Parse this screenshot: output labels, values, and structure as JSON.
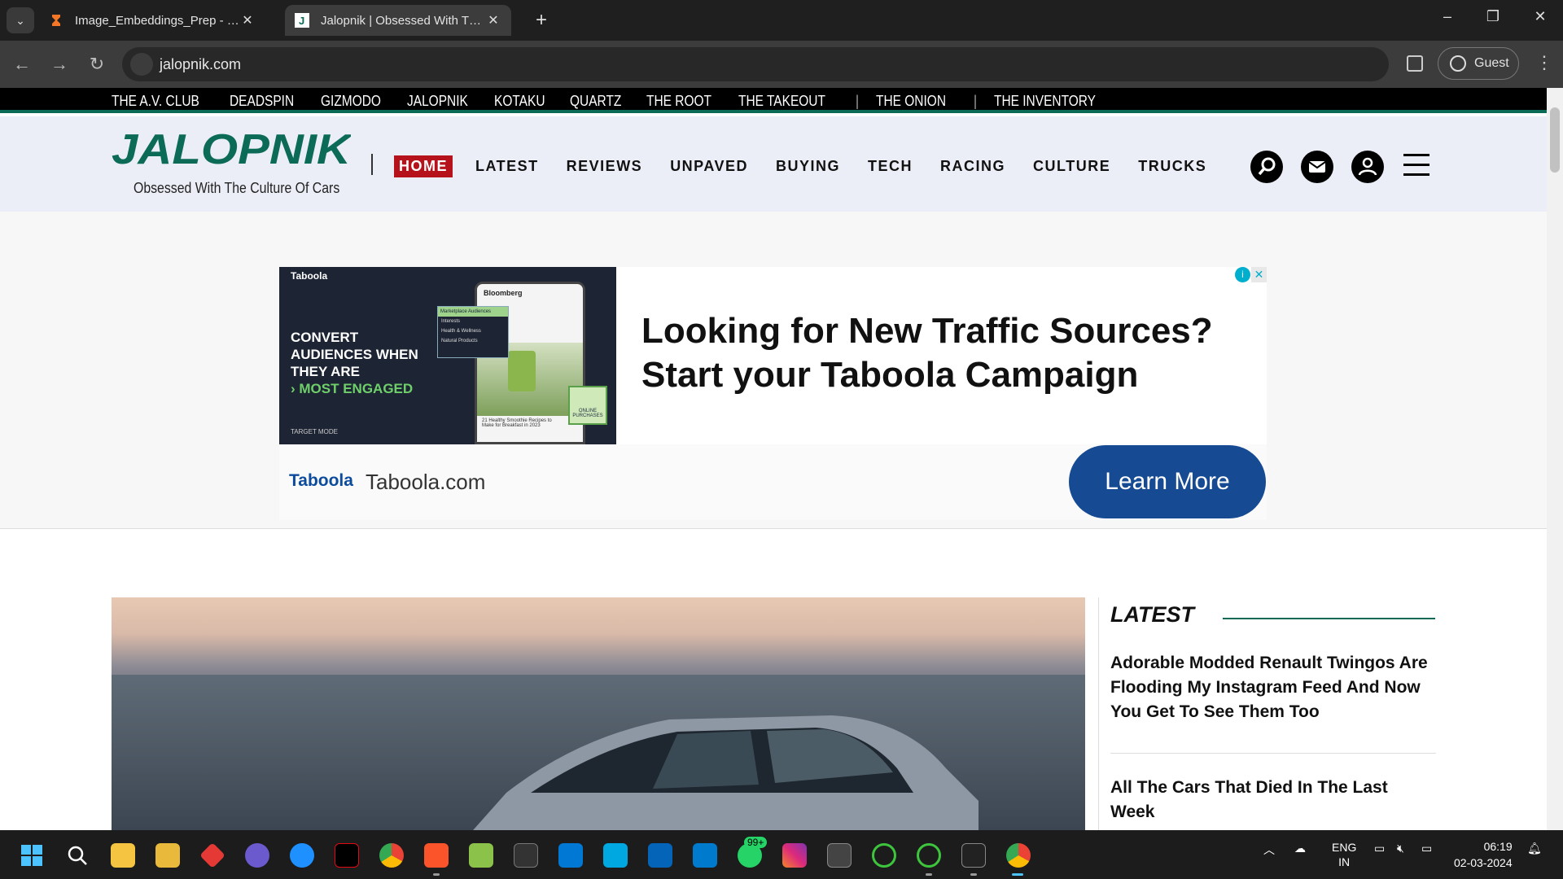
{
  "browser": {
    "tabs": [
      {
        "title": "Image_Embeddings_Prep - Jupyter",
        "active": false
      },
      {
        "title": "Jalopnik | Obsessed With The Culture Of Cars",
        "active": true
      }
    ],
    "url": "jalopnik.com",
    "profile_label": "Guest"
  },
  "network_bar": {
    "links": [
      "THE A.V. CLUB",
      "DEADSPIN",
      "GIZMODO",
      "JALOPNIK",
      "KOTAKU",
      "QUARTZ",
      "THE ROOT",
      "THE TAKEOUT"
    ],
    "links_after_sep1": [
      "THE ONION"
    ],
    "links_after_sep2": [
      "THE INVENTORY"
    ]
  },
  "header": {
    "logo_text": "JALOPNIK",
    "tagline": "Obsessed With The Culture Of Cars",
    "nav": [
      "HOME",
      "LATEST",
      "REVIEWS",
      "UNPAVED",
      "BUYING",
      "TECH",
      "RACING",
      "CULTURE",
      "TRUCKS"
    ]
  },
  "ad": {
    "creative_brand": "Taboola",
    "creative_line1": "CONVERT AUDIENCES WHEN THEY ARE",
    "creative_line2": "MOST ENGAGED",
    "creative_target": "TARGET MODE",
    "phone_brand": "Bloomberg",
    "phone_caption": "21 Healthy Smoothie Recipes to Make for Breakfast in 2023",
    "popup_header": "Marketplace Audiences",
    "popup_items": [
      "Interests",
      "Health & Wellness",
      "Natural Products"
    ],
    "badge": "ONLINE PURCHASES",
    "headline_line1": "Looking for New Traffic Sources?",
    "headline_line2": "Start your Taboola Campaign",
    "footer_logo": "Taboola",
    "domain": "Taboola.com",
    "cta": "Learn More"
  },
  "sidebar": {
    "title": "LATEST",
    "items": [
      "Adorable Modded Renault Twingos Are Flooding My Instagram Feed And Now You Get To See Them Too",
      "All The Cars That Died In The Last Week"
    ]
  },
  "taskbar": {
    "lang_line1": "ENG",
    "lang_line2": "IN",
    "time": "06:19",
    "date": "02-03-2024",
    "whatsapp_badge": "99+"
  },
  "colors": {
    "accent_green": "#0b6b57",
    "home_red": "#b5121b",
    "header_bg": "#eceef7",
    "cta_blue": "#164a93"
  }
}
